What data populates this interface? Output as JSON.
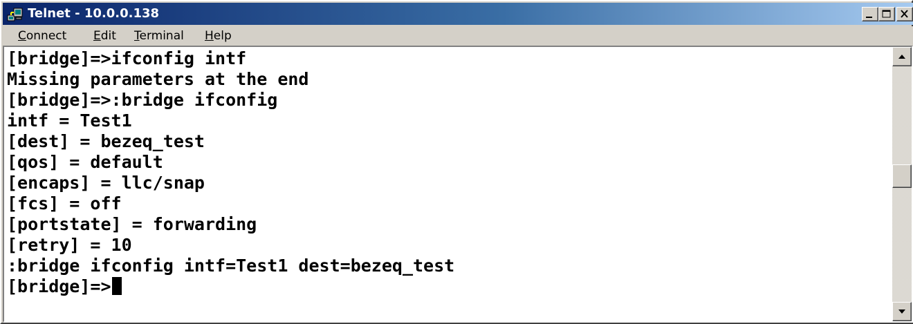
{
  "window": {
    "title": "Telnet - 10.0.0.138",
    "icon": "telnet-computer-icon"
  },
  "title_buttons": {
    "minimize_icon": "minimize-icon",
    "maximize_icon": "maximize-icon",
    "close_icon": "close-icon"
  },
  "menu": {
    "connect": {
      "accel": "C",
      "rest": "onnect"
    },
    "edit": {
      "accel": "E",
      "rest": "dit"
    },
    "terminal": {
      "accel": "T",
      "rest": "erminal"
    },
    "help": {
      "accel": "H",
      "rest": "elp"
    }
  },
  "terminal": {
    "lines": [
      "[bridge]=>ifconfig intf",
      "Missing parameters at the end",
      "[bridge]=>:bridge ifconfig",
      "intf = Test1",
      "[dest] = bezeq_test",
      "[qos] = default",
      "[encaps] = llc/snap",
      "[fcs] = off",
      "[portstate] = forwarding",
      "[retry] = 10",
      ":bridge ifconfig intf=Test1 dest=bezeq_test",
      "[bridge]=>"
    ]
  },
  "scrollbar": {
    "up_icon": "scroll-up-arrow-icon",
    "down_icon": "scroll-down-arrow-icon"
  },
  "colors": {
    "title_gradient_start": "#0a246a",
    "title_gradient_end": "#a6caf0",
    "face": "#d4d0c8",
    "terminal_bg": "#ffffff",
    "terminal_fg": "#000000"
  }
}
